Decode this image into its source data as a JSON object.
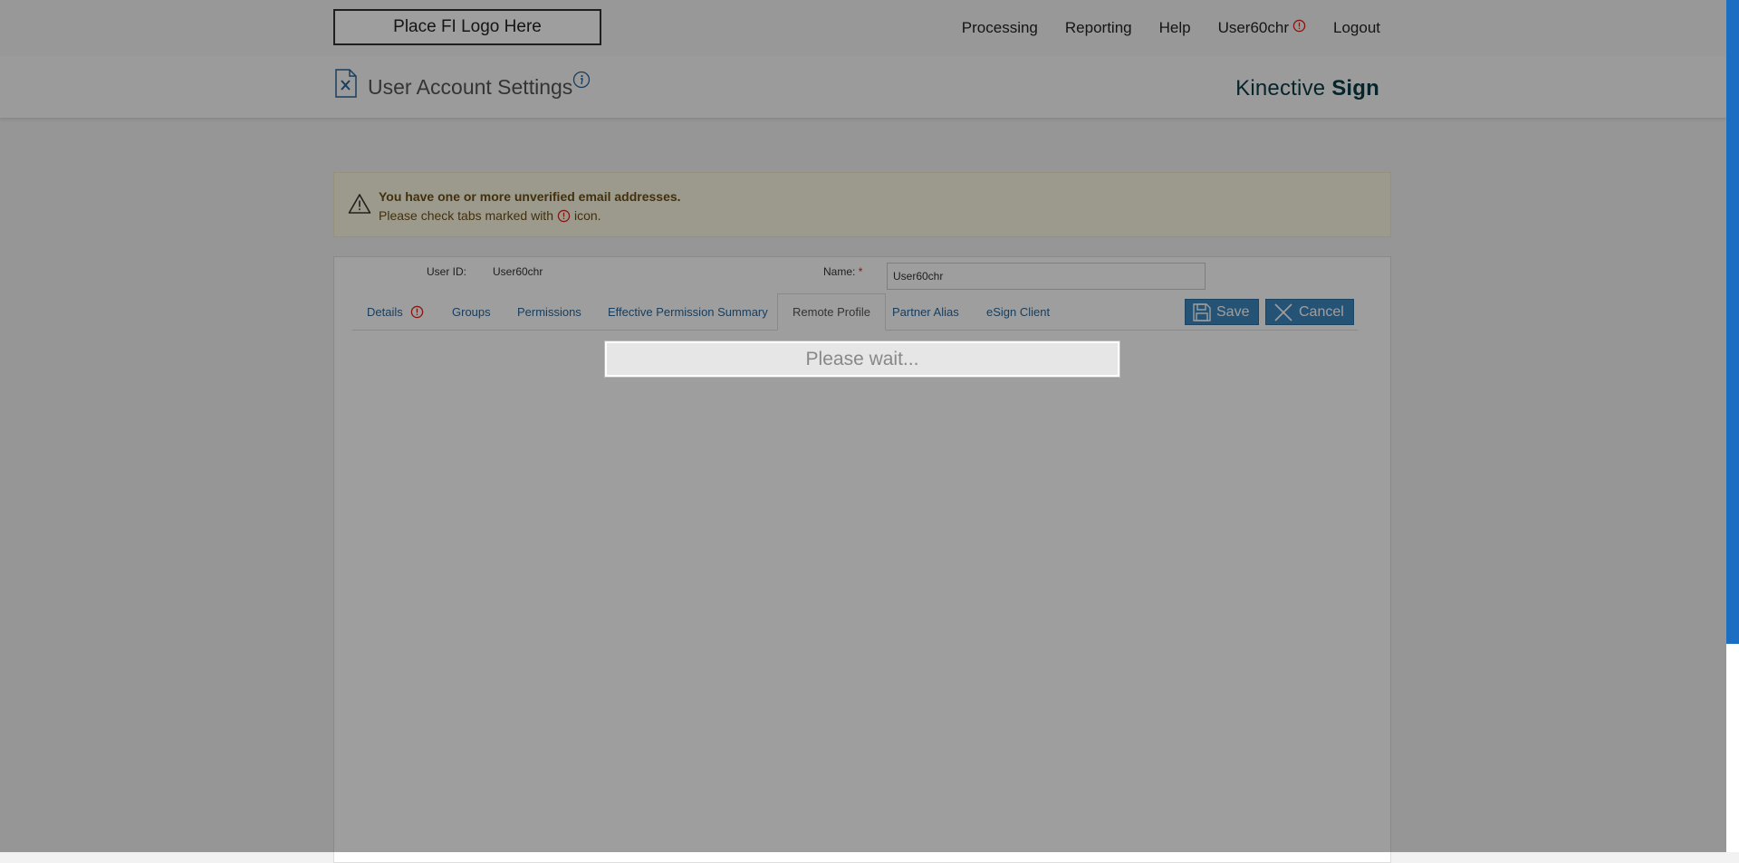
{
  "topbar": {
    "logo_text": "Place FI Logo Here",
    "nav": [
      {
        "label": "Processing"
      },
      {
        "label": "Reporting"
      },
      {
        "label": "Help"
      },
      {
        "label": "User60chr",
        "has_alert_icon": true
      },
      {
        "label": "Logout"
      }
    ]
  },
  "header": {
    "title": "User Account Settings",
    "brand_light": "Kinective ",
    "brand_bold": "Sign"
  },
  "warning": {
    "line1": "You have one or more unverified email addresses.",
    "line2_before": "Please check tabs marked with",
    "line2_after": "icon."
  },
  "form": {
    "user_id_label": "User ID:",
    "user_id_value": "User60chr",
    "name_label": "Name:",
    "name_required_mark": "*",
    "name_value": "User60chr"
  },
  "tabs": [
    {
      "label": "Details",
      "has_alert_icon": true
    },
    {
      "label": "Groups"
    },
    {
      "label": "Permissions"
    },
    {
      "label": "Effective Permission Summary"
    },
    {
      "label": "Remote Profile",
      "active": true
    },
    {
      "label": "Partner Alias"
    },
    {
      "label": "eSign Client"
    }
  ],
  "buttons": {
    "save_label": "Save",
    "cancel_label": "Cancel"
  },
  "overlay": {
    "message": "Please wait..."
  },
  "colors": {
    "accent": "#3c86bd",
    "alert": "#d9231a",
    "brand": "#0c3b45",
    "scrollbar": "#1b6ec2"
  }
}
